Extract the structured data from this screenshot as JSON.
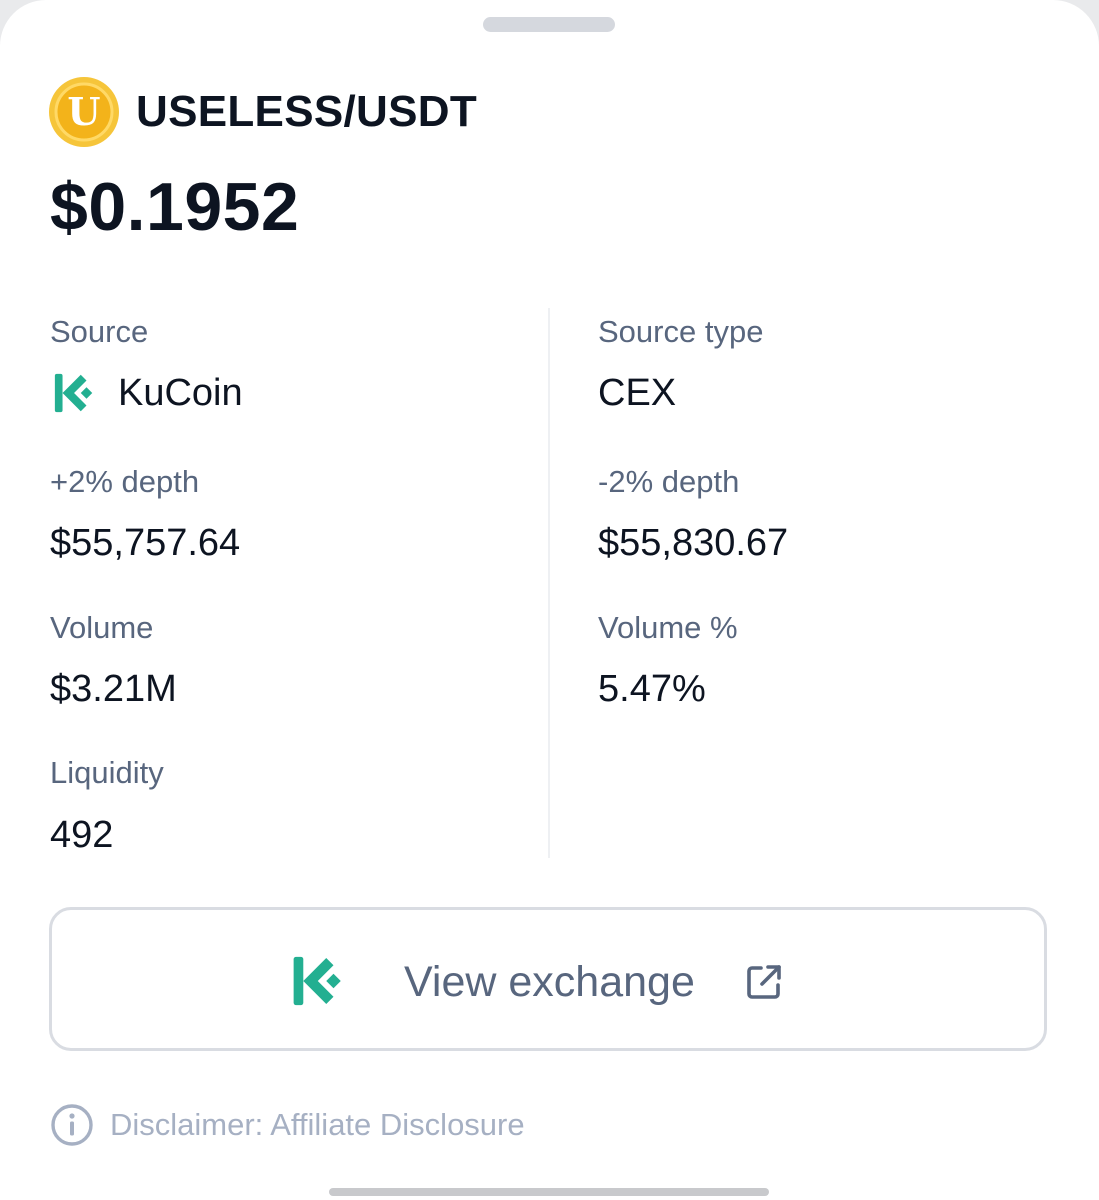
{
  "pair": {
    "icon": "useless-coin-icon",
    "icon_letter": "U",
    "title": "USELESS/USDT",
    "price": "$0.1952"
  },
  "colors": {
    "coin_gold": "#f3b31a",
    "kucoin_green": "#23af91",
    "label_gray": "#58667e",
    "value_dark": "#0d1421"
  },
  "fields": {
    "source": {
      "label": "Source",
      "value": "KuCoin",
      "icon": "kucoin-logo-icon"
    },
    "source_type": {
      "label": "Source type",
      "value": "CEX"
    },
    "plus_depth": {
      "label": "+2% depth",
      "value": "$55,757.64"
    },
    "minus_depth": {
      "label": "-2% depth",
      "value": "$55,830.67"
    },
    "volume": {
      "label": "Volume",
      "value": "$3.21M"
    },
    "volume_pct": {
      "label": "Volume %",
      "value": "5.47%"
    },
    "liquidity": {
      "label": "Liquidity",
      "value": "492"
    }
  },
  "view_exchange": {
    "label": "View exchange",
    "icon": "kucoin-logo-icon",
    "trailing_icon": "external-link-icon"
  },
  "disclaimer": {
    "icon": "info-icon",
    "text": "Disclaimer: Affiliate Disclosure"
  }
}
